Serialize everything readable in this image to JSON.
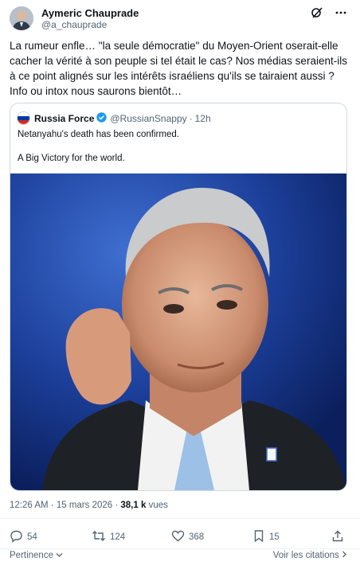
{
  "author": {
    "name": "Aymeric Chauprade",
    "handle": "@a_chauprade"
  },
  "tweet": {
    "text": "La rumeur enfle… \"la seule démocratie\" du Moyen-Orient oserait-elle cacher la vérité à son peuple si tel était le cas? Nos médias seraient-ils à ce point alignés sur les intérêts israéliens qu'ils se tairaient aussi ? Info ou intox nous saurons bientôt…"
  },
  "quote": {
    "name": "Russia Force",
    "handle": "@RussianSnappy",
    "dot": "·",
    "time": "12h",
    "line1": "Netanyahu's death has been confirmed.",
    "line2": "A Big Victory for the world.",
    "image_icon": "portrait-photo"
  },
  "meta": {
    "time": "12:26 AM",
    "sep": " · ",
    "date": "15 mars 2026",
    "views_count": "38,1 k",
    "views_label": " vues"
  },
  "actions": {
    "replies": "54",
    "reposts": "124",
    "likes": "368",
    "bookmarks": "15"
  },
  "footer": {
    "sort_label": "Pertinence",
    "quotes_label": "Voir les citations"
  },
  "colors": {
    "text_primary": "#0f1419",
    "text_secondary": "#536471",
    "verified_blue": "#1d9bf0",
    "border": "#cfd9de"
  }
}
